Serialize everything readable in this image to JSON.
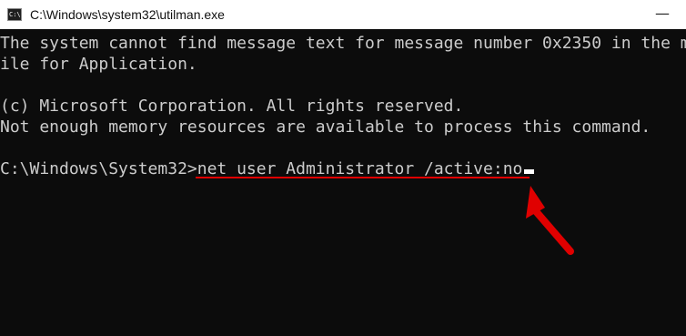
{
  "window": {
    "title": "C:\\Windows\\system32\\utilman.exe",
    "icon_text": "C:\\",
    "minimize_glyph": "—"
  },
  "console": {
    "lines": [
      "The system cannot find message text for message number 0x2350 in the message f",
      "ile for Application.",
      "",
      "(c) Microsoft Corporation. All rights reserved.",
      "Not enough memory resources are available to process this command."
    ],
    "prompt": "C:\\Windows\\System32>",
    "command": "net user Administrator /active:no"
  },
  "annotation": {
    "color": "#e00000"
  }
}
